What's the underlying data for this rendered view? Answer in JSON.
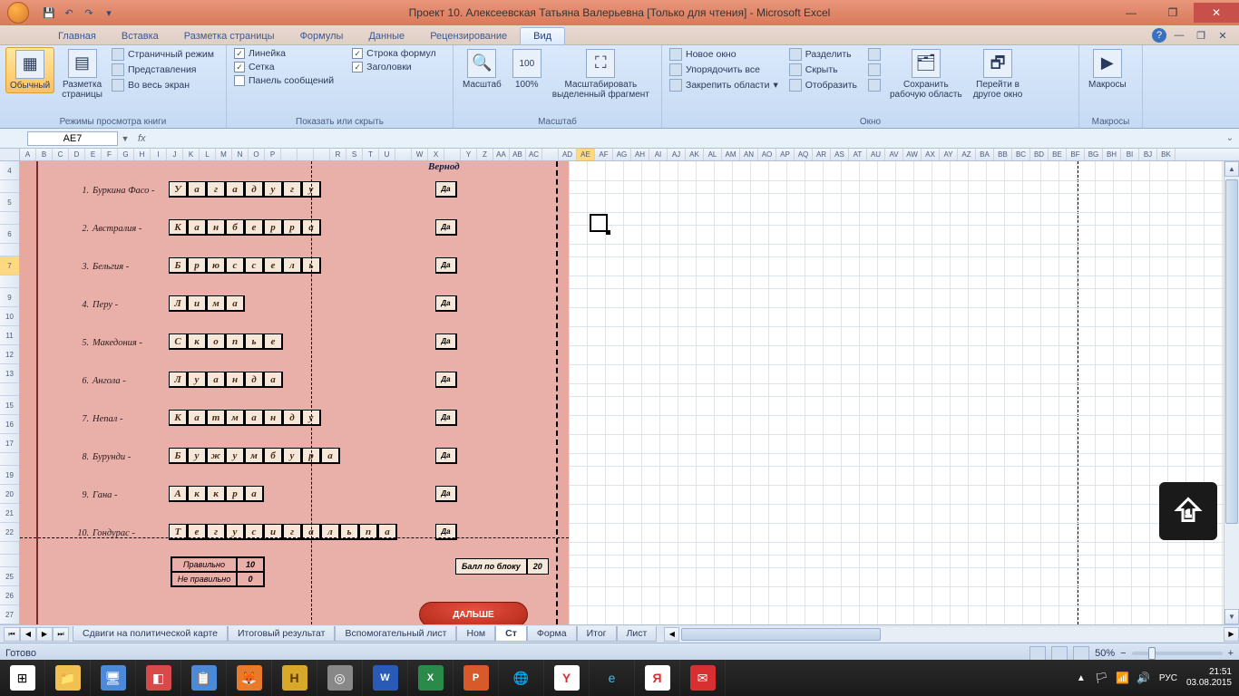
{
  "title": "Проект 10. Алексеевская Татьяна Валерьевна  [Только для чтения] - Microsoft Excel",
  "tabs": [
    "Главная",
    "Вставка",
    "Разметка страницы",
    "Формулы",
    "Данные",
    "Рецензирование",
    "Вид"
  ],
  "active_tab": "Вид",
  "ribbon": {
    "g1": {
      "label": "Режимы просмотра книги",
      "normal": "Обычный",
      "page_layout": "Разметка\nстраницы",
      "items": [
        "Страничный режим",
        "Представления",
        "Во весь экран"
      ]
    },
    "g2": {
      "label": "Показать или скрыть",
      "col1": [
        {
          "c": true,
          "t": "Линейка"
        },
        {
          "c": true,
          "t": "Сетка"
        },
        {
          "c": false,
          "t": "Панель сообщений"
        }
      ],
      "col2": [
        {
          "c": true,
          "t": "Строка формул"
        },
        {
          "c": true,
          "t": "Заголовки"
        }
      ]
    },
    "g3": {
      "label": "Масштаб",
      "zoom": "Масштаб",
      "hundred": "100%",
      "selection": "Масштабировать\nвыделенный фрагмент"
    },
    "g4": {
      "label": "Окно",
      "col1": [
        "Новое окно",
        "Упорядочить все",
        "Закрепить области"
      ],
      "col2": [
        "Разделить",
        "Скрыть",
        "Отобразить"
      ],
      "save_ws": "Сохранить\nрабочую область",
      "switch": "Перейти в\nдругое окно"
    },
    "g5": {
      "label": "Макросы",
      "macros": "Макросы"
    }
  },
  "namebox": "AE7",
  "columns": [
    "A",
    "B",
    "C",
    "D",
    "E",
    "F",
    "G",
    "H",
    "I",
    "J",
    "K",
    "L",
    "M",
    "N",
    "O",
    "P",
    "",
    "",
    "",
    "R",
    "S",
    "T",
    "U",
    "",
    "W",
    "X",
    "",
    "Y",
    "Z",
    "AA",
    "AB",
    "AC",
    "",
    "AD",
    "AE",
    "AF",
    "AG",
    "AH",
    "AI",
    "AJ",
    "AK",
    "AL",
    "AM",
    "AN",
    "AO",
    "AP",
    "AQ",
    "AR",
    "AS",
    "AT",
    "AU",
    "AV",
    "AW",
    "AX",
    "AY",
    "AZ",
    "BA",
    "BB",
    "BC",
    "BD",
    "BE",
    "BF",
    "BG",
    "BH",
    "BI",
    "BJ",
    "BK"
  ],
  "rows": [
    "4",
    "",
    "5",
    "",
    "6",
    "",
    "7",
    "",
    "9",
    "10",
    "11",
    "12",
    "13",
    "",
    "15",
    "16",
    "17",
    "",
    "19",
    "20",
    "21",
    "22",
    "",
    "",
    "25",
    "26",
    "27"
  ],
  "quiz_header": "Вернод",
  "quiz": [
    {
      "n": "1.",
      "country": "Буркина Фасо -",
      "letters": [
        "У",
        "а",
        "г",
        "а",
        "д",
        "у",
        "г",
        "у"
      ],
      "ok": "Да"
    },
    {
      "n": "2.",
      "country": "Австралия -",
      "letters": [
        "К",
        "а",
        "н",
        "б",
        "е",
        "р",
        "р",
        "а"
      ],
      "ok": "Да"
    },
    {
      "n": "3.",
      "country": "Бельгия -",
      "letters": [
        "Б",
        "р",
        "ю",
        "с",
        "с",
        "е",
        "л",
        "ь"
      ],
      "ok": "Да"
    },
    {
      "n": "4.",
      "country": "Перу -",
      "letters": [
        "Л",
        "и",
        "м",
        "а"
      ],
      "ok": "Да"
    },
    {
      "n": "5.",
      "country": "Македония -",
      "letters": [
        "С",
        "к",
        "о",
        "п",
        "ь",
        "е"
      ],
      "ok": "Да"
    },
    {
      "n": "6.",
      "country": "Ангола -",
      "letters": [
        "Л",
        "у",
        "а",
        "н",
        "д",
        "а"
      ],
      "ok": "Да"
    },
    {
      "n": "7.",
      "country": "Непал -",
      "letters": [
        "К",
        "а",
        "т",
        "м",
        "а",
        "н",
        "д",
        "у"
      ],
      "ok": "Да"
    },
    {
      "n": "8.",
      "country": "Бурунди -",
      "letters": [
        "Б",
        "у",
        "ж",
        "у",
        "м",
        "б",
        "у",
        "р",
        "а"
      ],
      "ok": "Да"
    },
    {
      "n": "9.",
      "country": "Гана -",
      "letters": [
        "А",
        "к",
        "к",
        "р",
        "а"
      ],
      "ok": "Да"
    },
    {
      "n": "10.",
      "country": "Гондурас -",
      "letters": [
        "Т",
        "е",
        "г",
        "у",
        "с",
        "и",
        "г",
        "а",
        "л",
        "ь",
        "п",
        "а"
      ],
      "ok": "Да"
    }
  ],
  "score": {
    "correct_label": "Правильно",
    "correct": "10",
    "wrong_label": "Не правильно",
    "wrong": "0"
  },
  "block": {
    "label": "Балл по блоку",
    "value": "20"
  },
  "next_btn": "ДАЛЬШЕ",
  "sheets": [
    "Сдвиги на политической карте",
    "Итоговый результат",
    "Вспомогательный лист",
    "Ном",
    "Ст",
    "Форма",
    "Итог",
    "Лист"
  ],
  "active_sheet": "Ст",
  "status": "Готово",
  "zoom": "50%",
  "tray": {
    "lang": "РУС",
    "time": "21:51",
    "date": "03.08.2015"
  }
}
